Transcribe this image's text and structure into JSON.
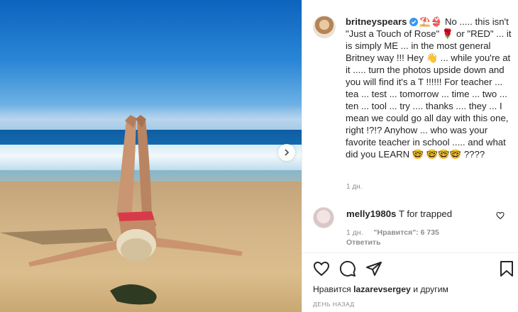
{
  "post": {
    "username": "britneyspears",
    "caption_emoji_lead": "⛱️👙",
    "caption_body": " No ..... this isn't \"Just a Touch of Rose\" 🌹 or \"RED\" ... it is simply ME ... in the most general Britney way !!! Hey 👋 ... while you're at it ..... turn the photos upside down and you will find it's a T !!!!!! For teacher ... tea ... test ... tomorrow ... time ... two ... ten ... tool ... try .... thanks .... they ... I mean we could go all day with this one, right !?!? Anyhow ... who was your favorite teacher in school ..... and what did you LEARN 🤓 🤓🤓🤓 ????",
    "time": "1 дн."
  },
  "comment": {
    "username": "melly1980s",
    "text": "T for trapped",
    "time": "1 дн.",
    "likes": "\"Нравится\": 6 735",
    "reply": "Ответить"
  },
  "footer": {
    "likes_prefix": "Нравится",
    "liked_by": "lazarevsergey",
    "likes_suffix": "и другим",
    "date": "ДЕНЬ НАЗАД"
  },
  "icons": {
    "verified": "verified-badge-icon",
    "like": "heart-icon",
    "comment": "comment-icon",
    "share": "share-icon",
    "save": "bookmark-icon",
    "carousel": "chevron-right-icon"
  },
  "colors": {
    "text": "#262626",
    "muted": "#8e8e8e",
    "verified": "#3897f0",
    "border": "#efefef"
  }
}
